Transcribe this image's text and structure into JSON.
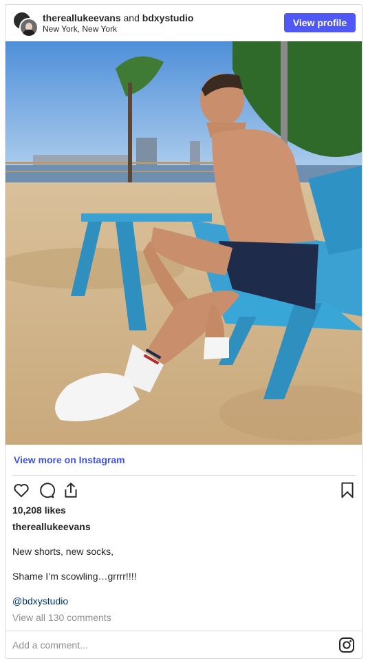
{
  "header": {
    "user1": "thereallukeevans",
    "and_text": "and",
    "user2": "bdxystudio",
    "location": "New York, New York",
    "view_profile": "View profile"
  },
  "photo": {
    "alt": "Man sitting on a blue Adirondack chair on the sand"
  },
  "view_more": "View more on Instagram",
  "actions": {
    "icons": [
      "heart-icon",
      "comment-icon",
      "share-icon",
      "bookmark-icon"
    ]
  },
  "likes": "10,208 likes",
  "caption": {
    "username": "thereallukeevans",
    "line1": "New shorts, new socks,",
    "line2": "Shame I’m scowling…grrrr!!!!",
    "mention": "@bdxystudio"
  },
  "comments_link": "View all 130 comments",
  "comment_box": {
    "placeholder": "Add a comment..."
  },
  "colors": {
    "accent": "#4f57f5",
    "link": "#3f53e2",
    "mention": "#00376b",
    "muted": "#8e8e8e"
  }
}
